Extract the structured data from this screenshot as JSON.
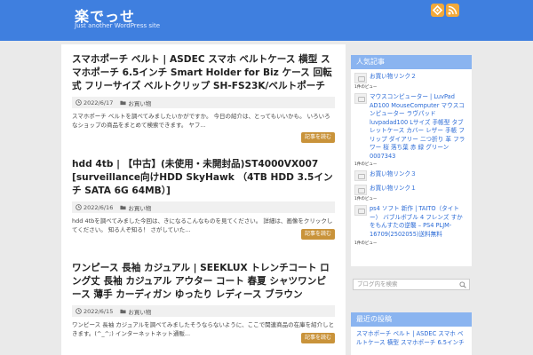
{
  "header": {
    "site_title": "楽でっせ",
    "site_description": "Just another WordPress site",
    "icons": [
      "feedly-icon",
      "rss-icon"
    ],
    "accent_color": "#3f7fdf"
  },
  "posts": [
    {
      "title": "スマホポーチ ベルト | ASDEC スマホ ベルトケース 横型 スマホポーチ 6.5インチ Smart Holder for Biz ケース 回転式 フリーサイズ ベルトクリップ SH-FS23K/ベルトポーチ",
      "date": "2022/6/17",
      "category": "お買い物",
      "excerpt": "スマホポーチ ベルトを調べてみましたいかがですか。 今日の紹介は、とってもいいかも。 いろいろなショップの商品をまとめて検索できます。 ヤフ...",
      "read_more": "記事を読む"
    },
    {
      "title": "hdd 4tb | 【中古】(未使用・未開封品)ST4000VX007 [surveillance向けHDD SkyHawk （4TB HDD 3.5インチ SATA 6G 64MB）]",
      "date": "2022/6/16",
      "category": "お買い物",
      "excerpt": "hdd 4tbを調べてみました今回は、きになるこんなものを見てください。 詳細は、画像をクリックしてください。 知る人ぞ知る！ さがしていた...",
      "read_more": "記事を読む"
    },
    {
      "title": "ワンピース 長袖 カジュアル | SEEKLUX トレンチコート ロング丈 長袖 カジュアル アウター コート 春夏 シャツワンピース 薄手 カーディガン ゆったり レディース ブラウン",
      "date": "2022/6/15",
      "category": "お買い物",
      "excerpt": "ワンピース 長袖 カジュアルを調べてみましたそうならないように、ここで関連商品の在庫を紹介しときます。(^_^;) インターネットネット通販...",
      "read_more": "記事を読む"
    }
  ],
  "sidebar": {
    "popular_title": "人気記事",
    "popular": [
      {
        "title": "お買い物リンク２",
        "views": "1件のビュー"
      },
      {
        "title": "マウスコンピューター | LuvPad AD100 MouseComputer マウスコンピューター ラヴパッド luvpadad100 Lサイズ 手帳型 タブレットケース カバー レザー 手帳 フリップ ダイアリー 二つ折り 革 フラワー 桜 落ち葉 赤 緑 グリーン 0007343",
        "views": "1件のビュー"
      },
      {
        "title": "お買い物リンク３",
        "views": ""
      },
      {
        "title": "お買い物リンク１",
        "views": "1件のビュー"
      },
      {
        "title": "ps4 ソフト 新作 | TAITO（タイトー） バブルボブル 4 フレンズ すかをもんすたの逆襲 – PS4 PLJM-16709(2502055)送料無料",
        "views": "1件のビュー"
      }
    ],
    "search_placeholder": "ブログ内を検索",
    "recent_title": "最近の投稿",
    "recent": [
      "スマホポーチ ベルト | ASDEC スマホ ベルトケース 横型 スマホポーチ 6.5インチ"
    ]
  }
}
